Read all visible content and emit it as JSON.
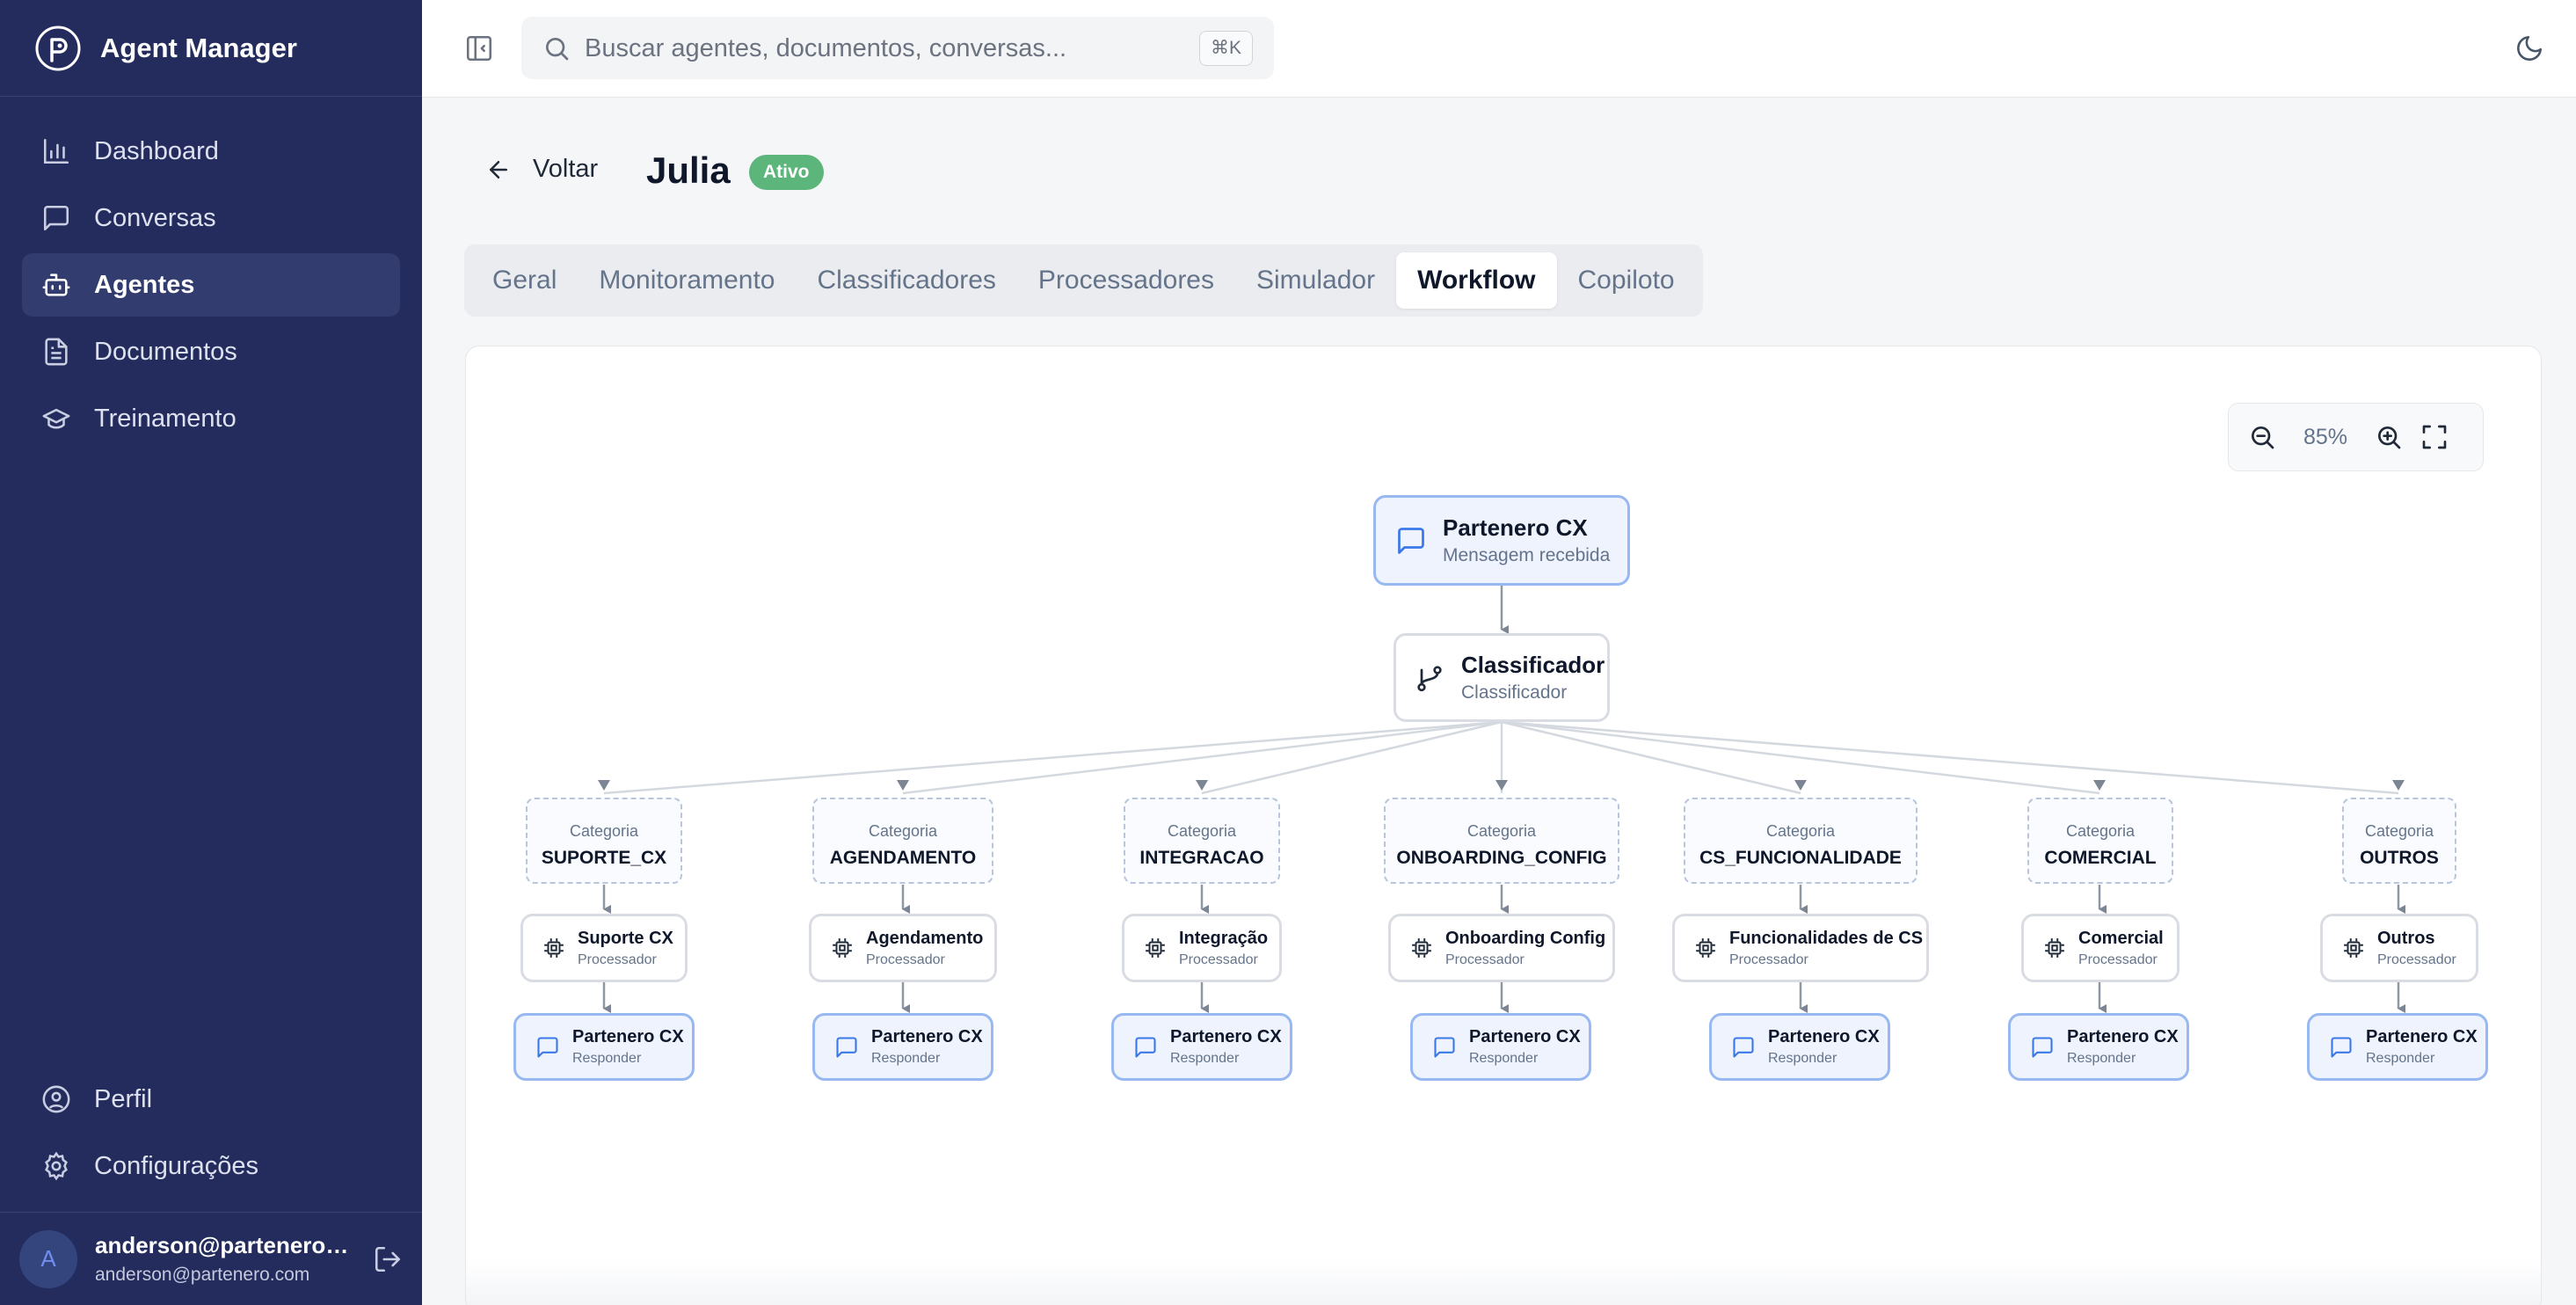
{
  "app": {
    "title": "Agent Manager"
  },
  "sidebar": {
    "items": [
      {
        "label": "Dashboard",
        "icon": "bar-chart-icon"
      },
      {
        "label": "Conversas",
        "icon": "message-square-icon"
      },
      {
        "label": "Agentes",
        "icon": "bot-icon",
        "active": true
      },
      {
        "label": "Documentos",
        "icon": "file-text-icon"
      },
      {
        "label": "Treinamento",
        "icon": "graduation-cap-icon"
      }
    ],
    "bottom_items": [
      {
        "label": "Perfil",
        "icon": "user-circle-icon"
      },
      {
        "label": "Configurações",
        "icon": "gear-icon"
      }
    ],
    "user": {
      "initial": "A",
      "name": "anderson@partenero....",
      "email": "anderson@partenero.com"
    }
  },
  "topbar": {
    "search_placeholder": "Buscar agentes, documentos, conversas...",
    "shortcut": "⌘K"
  },
  "header": {
    "back_label": "Voltar",
    "agent_name": "Julia",
    "status_badge": "Ativo"
  },
  "tabs": [
    {
      "label": "Geral"
    },
    {
      "label": "Monitoramento"
    },
    {
      "label": "Classificadores"
    },
    {
      "label": "Processadores"
    },
    {
      "label": "Simulador"
    },
    {
      "label": "Workflow",
      "active": true
    },
    {
      "label": "Copiloto"
    }
  ],
  "workflow": {
    "zoom": "85%",
    "trigger": {
      "title": "Partenero CX",
      "subtitle": "Mensagem recebida"
    },
    "classifier": {
      "title": "Classificador",
      "subtitle": "Classificador"
    },
    "category_label": "Categoria",
    "processor_label": "Processador",
    "responder": {
      "title": "Partenero CX",
      "subtitle": "Responder"
    },
    "branches": [
      {
        "category": "SUPORTE_CX",
        "processor": "Suporte CX"
      },
      {
        "category": "AGENDAMENTO",
        "processor": "Agendamento"
      },
      {
        "category": "INTEGRACAO",
        "processor": "Integração"
      },
      {
        "category": "ONBOARDING_CONFIG",
        "processor": "Onboarding Config"
      },
      {
        "category": "CS_FUNCIONALIDADE",
        "processor": "Funcionalidades de CS"
      },
      {
        "category": "COMERCIAL",
        "processor": "Comercial"
      },
      {
        "category": "OUTROS",
        "processor": "Outros"
      }
    ]
  }
}
